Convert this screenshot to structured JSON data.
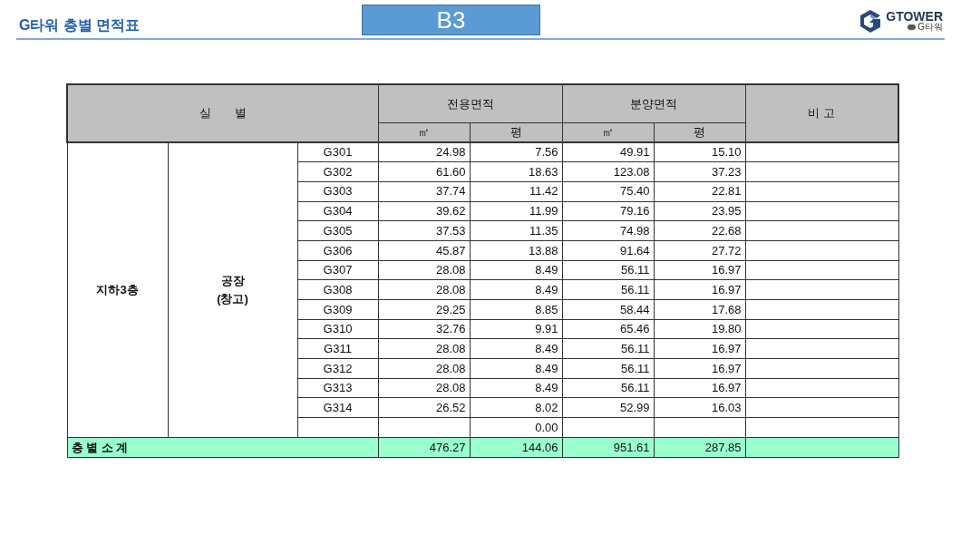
{
  "header": {
    "title": "G타워 층별 면적표",
    "floor_badge": "B3",
    "logo": {
      "name": "GTOWER",
      "sub": "G타워"
    }
  },
  "table": {
    "header": {
      "room": "실　　별",
      "exclusive": "전용면적",
      "sale": "분양면적",
      "note": "비 고",
      "units": [
        "㎡",
        "평",
        "㎡",
        "평"
      ]
    },
    "floor": "지하3층",
    "use": "공장\n(창고)",
    "rows": [
      {
        "room": "G301",
        "ex_m2": "24.98",
        "ex_py": "7.56",
        "sale_m2": "49.91",
        "sale_py": "15.10"
      },
      {
        "room": "G302",
        "ex_m2": "61.60",
        "ex_py": "18.63",
        "sale_m2": "123.08",
        "sale_py": "37.23"
      },
      {
        "room": "G303",
        "ex_m2": "37.74",
        "ex_py": "11.42",
        "sale_m2": "75.40",
        "sale_py": "22.81"
      },
      {
        "room": "G304",
        "ex_m2": "39.62",
        "ex_py": "11.99",
        "sale_m2": "79.16",
        "sale_py": "23.95"
      },
      {
        "room": "G305",
        "ex_m2": "37.53",
        "ex_py": "11.35",
        "sale_m2": "74.98",
        "sale_py": "22.68"
      },
      {
        "room": "G306",
        "ex_m2": "45.87",
        "ex_py": "13.88",
        "sale_m2": "91.64",
        "sale_py": "27.72"
      },
      {
        "room": "G307",
        "ex_m2": "28.08",
        "ex_py": "8.49",
        "sale_m2": "56.11",
        "sale_py": "16.97"
      },
      {
        "room": "G308",
        "ex_m2": "28.08",
        "ex_py": "8.49",
        "sale_m2": "56.11",
        "sale_py": "16.97"
      },
      {
        "room": "G309",
        "ex_m2": "29.25",
        "ex_py": "8.85",
        "sale_m2": "58.44",
        "sale_py": "17.68"
      },
      {
        "room": "G310",
        "ex_m2": "32.76",
        "ex_py": "9.91",
        "sale_m2": "65.46",
        "sale_py": "19.80"
      },
      {
        "room": "G311",
        "ex_m2": "28.08",
        "ex_py": "8.49",
        "sale_m2": "56.11",
        "sale_py": "16.97"
      },
      {
        "room": "G312",
        "ex_m2": "28.08",
        "ex_py": "8.49",
        "sale_m2": "56.11",
        "sale_py": "16.97"
      },
      {
        "room": "G313",
        "ex_m2": "28.08",
        "ex_py": "8.49",
        "sale_m2": "56.11",
        "sale_py": "16.97"
      },
      {
        "room": "G314",
        "ex_m2": "26.52",
        "ex_py": "8.02",
        "sale_m2": "52.99",
        "sale_py": "16.03"
      },
      {
        "ex_py": "0.00"
      }
    ],
    "subtotal": {
      "label": "층 별 소 계",
      "ex_m2": "476.27",
      "ex_py": "144.06",
      "sale_m2": "951.61",
      "sale_py": "287.85"
    }
  }
}
